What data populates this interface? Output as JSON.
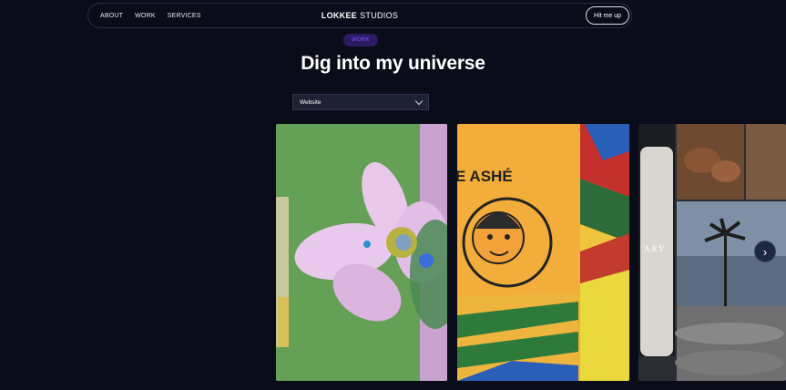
{
  "nav": {
    "links": [
      "ABOUT",
      "WORK",
      "SERVICES"
    ],
    "brand_bold": "LOKKEE",
    "brand_light": "STUDIOS",
    "cta_label": "Hit me up"
  },
  "hero": {
    "badge": "WORK",
    "title": "Dig into my universe"
  },
  "filter": {
    "selected": "Website"
  },
  "cards": {
    "ashe_text": "E ASHÉ",
    "ary_text": "ARY"
  },
  "carousel": {
    "next_icon": "chevron-right-icon"
  }
}
